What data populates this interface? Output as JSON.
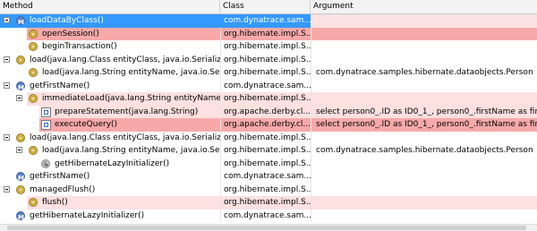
{
  "columns": {
    "method": "Method",
    "class": "Class",
    "argument": "Argument"
  },
  "rows": [
    {
      "indent": 0,
      "toggle": true,
      "icon": "method-icon",
      "method": "loadDataByClass()",
      "class": "com.dynatrace.sam...",
      "argument": "",
      "state": "selected"
    },
    {
      "indent": 1,
      "toggle": false,
      "icon": "gear-icon",
      "method": "openSession()",
      "class": "org.hibernate.impl.S...",
      "argument": "",
      "state": "red"
    },
    {
      "indent": 1,
      "toggle": false,
      "icon": "gear-icon",
      "method": "beginTransaction()",
      "class": "org.hibernate.impl.S...",
      "argument": "",
      "state": "none"
    },
    {
      "indent": 0,
      "toggle": true,
      "icon": "gear-icon",
      "method": "load(java.lang.Class entityClass, java.io.Serializ",
      "class": "org.hibernate.impl.S...",
      "argument": "",
      "state": "none"
    },
    {
      "indent": 1,
      "toggle": false,
      "icon": "gear-icon",
      "method": "load(java.lang.String entityName, java.io.Ser",
      "class": "org.hibernate.impl.S...",
      "argument": "com.dynatrace.samples.hibernate.dataobjects.Person",
      "state": "none"
    },
    {
      "indent": 0,
      "toggle": true,
      "icon": "method-icon",
      "method": "getFirstName()",
      "class": "com.dynatrace.sam...",
      "argument": "",
      "state": "none"
    },
    {
      "indent": 1,
      "toggle": true,
      "icon": "gear-icon",
      "method": "immediateLoad(java.lang.String entityName,",
      "class": "org.hibernate.impl.S...",
      "argument": "",
      "state": "pink"
    },
    {
      "indent": 2,
      "toggle": false,
      "icon": "sql-icon",
      "method": "prepareStatement(java.lang.String)",
      "class": "org.apache.derby.cl...",
      "argument": "select person0_.ID as ID0_1_, person0_.firstName as fir...",
      "state": "pink"
    },
    {
      "indent": 2,
      "toggle": false,
      "icon": "sql-icon",
      "method": "executeQuery()",
      "class": "org.apache.derby.cl...",
      "argument": "select person0_.ID as ID0_1_, person0_.firstName as fir...",
      "state": "red"
    },
    {
      "indent": 0,
      "toggle": true,
      "icon": "gear-icon",
      "method": "load(java.lang.Class entityClass, java.io.Serializ",
      "class": "org.hibernate.impl.S...",
      "argument": "",
      "state": "none"
    },
    {
      "indent": 1,
      "toggle": true,
      "icon": "gear-icon",
      "method": "load(java.lang.String entityName, java.io.Ser",
      "class": "org.hibernate.impl.S...",
      "argument": "com.dynatrace.samples.hibernate.dataobjects.Person",
      "state": "none"
    },
    {
      "indent": 2,
      "toggle": false,
      "icon": "arrow-icon",
      "method": "getHibernateLazyInitializer()",
      "class": "org.hibernate.impl.S...",
      "argument": "",
      "state": "none"
    },
    {
      "indent": 0,
      "toggle": false,
      "icon": "method-icon",
      "method": "getFirstName()",
      "class": "com.dynatrace.sam...",
      "argument": "",
      "state": "none"
    },
    {
      "indent": 0,
      "toggle": true,
      "icon": "gear-icon",
      "method": "managedFlush()",
      "class": "org.hibernate.impl.S...",
      "argument": "",
      "state": "none"
    },
    {
      "indent": 1,
      "toggle": false,
      "icon": "gear-icon",
      "method": "flush()",
      "class": "org.hibernate.impl.S...",
      "argument": "",
      "state": "pink"
    },
    {
      "indent": 0,
      "toggle": false,
      "icon": "method-icon",
      "method": "getHibernateLazyInitializer()",
      "class": "com.dynatrace.sam...",
      "argument": "",
      "state": "none"
    }
  ],
  "colors": {
    "selected": "#3399ff",
    "pink": "#fde0e0",
    "red": "#f7a9a9"
  }
}
